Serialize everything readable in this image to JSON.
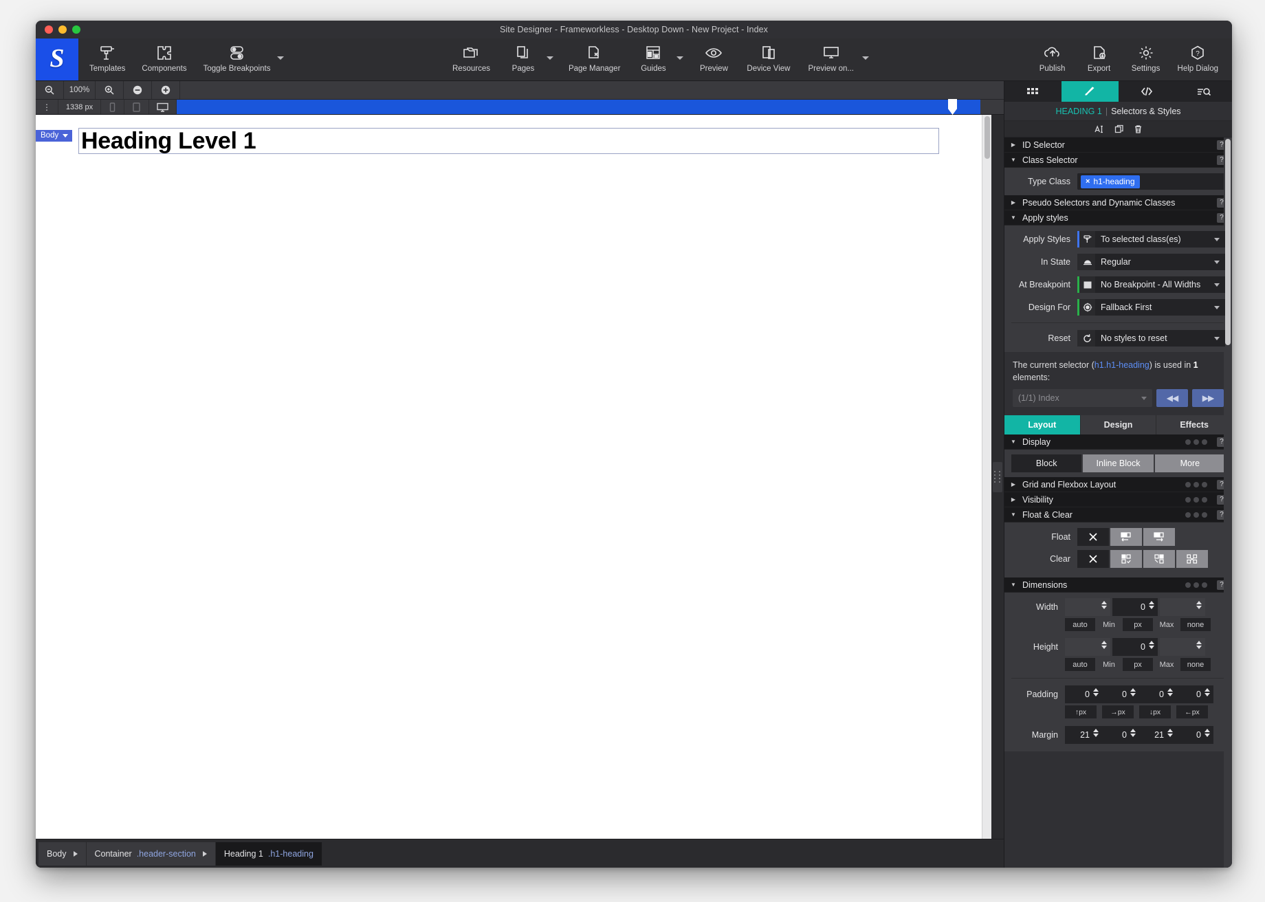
{
  "window": {
    "title": "Site Designer - Frameworkless - Desktop Down - New Project - Index"
  },
  "toolbar": {
    "left": [
      {
        "label": "Templates",
        "icon": "paint-roller-icon"
      },
      {
        "label": "Components",
        "icon": "puzzle-icon"
      },
      {
        "label": "Toggle Breakpoints",
        "icon": "toggles-icon"
      }
    ],
    "center": [
      {
        "label": "Resources",
        "icon": "folders-icon"
      },
      {
        "label": "Pages",
        "icon": "pages-icon"
      },
      {
        "label": "Page Manager",
        "icon": "page-manager-icon"
      },
      {
        "label": "Guides",
        "icon": "guides-icon"
      },
      {
        "label": "Preview",
        "icon": "eye-icon"
      },
      {
        "label": "Device View",
        "icon": "devices-icon"
      },
      {
        "label": "Preview on...",
        "icon": "monitor-icon"
      }
    ],
    "right": [
      {
        "label": "Publish",
        "icon": "cloud-upload-icon"
      },
      {
        "label": "Export",
        "icon": "file-export-icon"
      },
      {
        "label": "Settings",
        "icon": "gear-icon"
      },
      {
        "label": "Help Dialog",
        "icon": "help-hexagon-icon"
      }
    ]
  },
  "zoombar": {
    "zoom_out_label": "zoom-out-icon",
    "zoom_value": "100%",
    "zoom_in_label": "zoom-in-icon",
    "minus_label": "minus-icon",
    "plus_label": "plus-icon"
  },
  "breakpointbar": {
    "width_value": "1338 px",
    "phone_icon": "phone-icon",
    "tablet_icon": "tablet-icon",
    "desktop_icon": "desktop-icon"
  },
  "canvas": {
    "body_tag": "Body",
    "heading_text": "Heading Level 1"
  },
  "breadcrumb": {
    "items": [
      {
        "name": "Body",
        "cls": "",
        "active": false
      },
      {
        "name": "Container",
        "cls": ".header-section",
        "active": false
      },
      {
        "name": "Heading 1",
        "cls": ".h1-heading",
        "active": true
      }
    ]
  },
  "panel": {
    "tabs": [
      {
        "name": "grid-tab",
        "icon": "grid-icon",
        "active": false
      },
      {
        "name": "styles-tab",
        "icon": "brush-icon",
        "active": true
      },
      {
        "name": "code-tab",
        "icon": "code-icon",
        "active": false
      },
      {
        "name": "search-tab",
        "icon": "search-list-icon",
        "active": false
      }
    ],
    "title_element": "HEADING 1",
    "title_separator": "|",
    "title_rest": "Selectors & Styles",
    "icon_row": [
      {
        "name": "text-cursor-icon"
      },
      {
        "name": "duplicate-icon"
      },
      {
        "name": "trash-icon"
      }
    ],
    "sections": {
      "id_selector": "ID Selector",
      "class_selector": "Class Selector",
      "type_class_label": "Type Class",
      "type_class_tag": "h1-heading",
      "type_class_tag_remove": "×",
      "pseudo_selectors": "Pseudo Selectors and Dynamic Classes",
      "apply_styles": "Apply styles",
      "help": "?"
    },
    "apply": {
      "apply_styles_label": "Apply Styles",
      "apply_styles_value": "To selected class(es)",
      "in_state_label": "In State",
      "in_state_value": "Regular",
      "at_breakpoint_label": "At Breakpoint",
      "at_breakpoint_value": "No Breakpoint - All Widths",
      "design_for_label": "Design For",
      "design_for_value": "Fallback First",
      "reset_label": "Reset",
      "reset_value": "No styles to reset"
    },
    "usage": {
      "text_before": "The current selector (",
      "selector": "h1.h1-heading",
      "text_mid": ") is used in ",
      "count": "1",
      "text_after": " elements:",
      "element_value": "(1/1) Index",
      "prev_label": "◀◀",
      "next_label": "▶▶"
    },
    "style_tabs": [
      {
        "label": "Layout",
        "active": true
      },
      {
        "label": "Design",
        "active": false
      },
      {
        "label": "Effects",
        "active": false
      }
    ],
    "display": {
      "section": "Display",
      "options": [
        {
          "label": "Block",
          "active": true
        },
        {
          "label": "Inline Block",
          "active": false
        },
        {
          "label": "More",
          "active": false
        }
      ]
    },
    "grid_flexbox": "Grid and Flexbox Layout",
    "visibility": "Visibility",
    "float_clear": {
      "section": "Float & Clear",
      "float_label": "Float",
      "float_buttons": [
        {
          "name": "float-none-icon",
          "active": true
        },
        {
          "name": "float-left-icon",
          "active": false
        },
        {
          "name": "float-right-icon",
          "active": false
        }
      ],
      "clear_label": "Clear",
      "clear_buttons": [
        {
          "name": "clear-none-icon",
          "active": true
        },
        {
          "name": "clear-left-icon",
          "active": false
        },
        {
          "name": "clear-right-icon",
          "active": false
        },
        {
          "name": "clear-both-icon",
          "active": false
        }
      ]
    },
    "dimensions": {
      "section": "Dimensions",
      "width_label": "Width",
      "width_min": "",
      "width_value": "0",
      "width_max": "",
      "width_units": [
        "auto",
        "Min",
        "px",
        "Max",
        "none"
      ],
      "height_label": "Height",
      "height_min": "",
      "height_value": "0",
      "height_max": "",
      "height_units": [
        "auto",
        "Min",
        "px",
        "Max",
        "none"
      ],
      "padding_label": "Padding",
      "padding_values": [
        "0",
        "0",
        "0",
        "0"
      ],
      "padding_units": [
        "↑px",
        "→px",
        "↓px",
        "←px"
      ],
      "margin_label": "Margin",
      "margin_values": [
        "21",
        "0",
        "21",
        "0"
      ]
    }
  },
  "colors": {
    "accent_teal": "#12b5a5",
    "accent_blue": "#1a56db",
    "tag_blue": "#2f6ef0",
    "panel_bg": "#3a3a3e",
    "dark_bg": "#232326"
  }
}
